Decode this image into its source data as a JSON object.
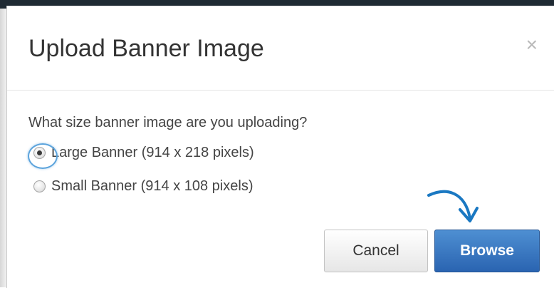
{
  "dialog": {
    "title": "Upload Banner Image",
    "close_label": "×",
    "question": "What size banner image are you uploading?",
    "options": [
      {
        "label": "Large Banner (914 x 218 pixels)",
        "checked": true
      },
      {
        "label": "Small Banner (914 x 108 pixels)",
        "checked": false
      }
    ],
    "buttons": {
      "cancel_label": "Cancel",
      "browse_label": "Browse"
    }
  },
  "colors": {
    "primary_button": "#2f6db8",
    "highlight_ring": "#5ba3dc",
    "annotation_arrow": "#1a78c2"
  },
  "icons": {
    "close": "close-icon",
    "annotation_arrow": "curved-arrow-icon"
  }
}
